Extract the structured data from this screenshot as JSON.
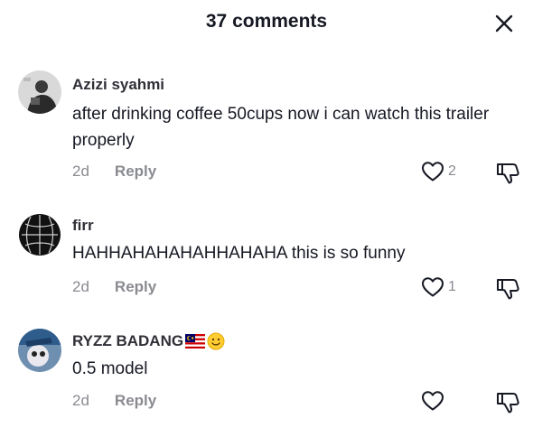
{
  "header": {
    "title": "37 comments",
    "close_icon": "close-icon"
  },
  "comments": [
    {
      "username": "Azizi syahmi",
      "text": "after drinking coffee 50cups now i can watch this trailer properly",
      "date": "2d",
      "reply_label": "Reply",
      "likes": "2"
    },
    {
      "username": "firr",
      "text": "HAHHAHAHAHAHHAHAHA this is so funny",
      "date": "2d",
      "reply_label": "Reply",
      "likes": "1"
    },
    {
      "username": "RYZZ BADANG",
      "username_emojis": [
        "malaysia-flag-emoji",
        "smiling-face-emoji"
      ],
      "text": "0.5 model",
      "date": "2d",
      "reply_label": "Reply",
      "likes": ""
    }
  ],
  "icons": {
    "like": "heart-outline-icon",
    "dislike": "thumbs-down-outline-icon"
  }
}
